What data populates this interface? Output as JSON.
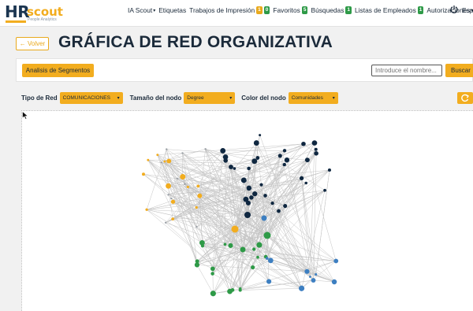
{
  "header": {
    "logo_hr": "HR",
    "logo_scout": "scout",
    "logo_sub": "People Analytics",
    "nav": [
      {
        "label": "IA Scout",
        "dropdown": true
      },
      {
        "label": "Etiquetas"
      },
      {
        "label": "Trabajos de Impresión",
        "badges": [
          {
            "text": "1",
            "color": "#e9a91c"
          },
          {
            "text": "0",
            "color": "#2e9a47"
          }
        ]
      },
      {
        "label": "Favoritos",
        "badges": [
          {
            "text": "5",
            "color": "#2e9a47"
          }
        ]
      },
      {
        "label": "Búsquedas",
        "badges": [
          {
            "text": "1",
            "color": "#2e9a47"
          }
        ]
      },
      {
        "label": "Listas de Empleados",
        "badges": [
          {
            "text": "1",
            "color": "#2e9a47"
          }
        ]
      },
      {
        "label": "Autorizaciones",
        "dropdown": true
      }
    ],
    "power_icon": "power-icon",
    "language": "Esp"
  },
  "page": {
    "back_label": "← Volver",
    "title": "GRÁFICA DE RED ORGANIZATIVA"
  },
  "toolbar": {
    "segment_button": "Analisis de Segmentos",
    "search_placeholder": "Introduce el nombre...",
    "search_button": "Buscar"
  },
  "filters": {
    "network_type_label": "Tipo de Red",
    "network_type_value": "COMUNICACIONES",
    "node_size_label": "Tamaño del nodo",
    "node_size_value": "Degree",
    "node_color_label": "Color del nodo",
    "node_color_value": "Comunidades",
    "refresh_icon": "refresh-icon"
  },
  "colors": {
    "accent": "#f2ad1f",
    "community_navy": "#0f2740",
    "community_yellow": "#f2ad1f",
    "community_green": "#2e9a47",
    "community_blue": "#3d7fc1",
    "edge": "#c4c4c4"
  }
}
